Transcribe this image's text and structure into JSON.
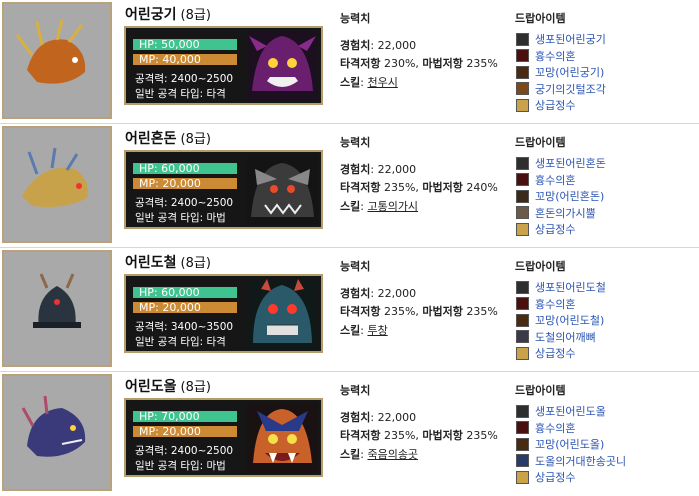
{
  "headers": {
    "ability": "능력치",
    "drop": "드랍아이템"
  },
  "labels": {
    "exp": "경험치",
    "resist": "타격저항",
    "magic_resist": "마법저항",
    "skill": "스킬",
    "attack": "공격력",
    "attack_type": "일반 공격 타입"
  },
  "monsters": [
    {
      "name": "어린궁기",
      "grade": "(8급)",
      "hp": "HP: 50,000",
      "mp": "MP: 40,000",
      "attack": "공격력: 2400~2500",
      "attack_type": "일반 공격 타입: 타격",
      "exp": ": 22,000",
      "resist": " 230%, ",
      "magic_resist": " 235%",
      "skill": ": ",
      "skill_name": "천우시",
      "drops": [
        "생포된어린궁기",
        "흉수의혼",
        "꼬망(어린궁기)",
        "궁기의깃털조각",
        "상급정수"
      ],
      "drop_icon_colors": [
        "#2e2e2e",
        "#4a1010",
        "#4a2a10",
        "#7a4a1a",
        "#c9a24a"
      ],
      "portrait_color": "#6a1f6e",
      "body_color": "#c0641e"
    },
    {
      "name": "어린혼돈",
      "grade": "(8급)",
      "hp": "HP: 60,000",
      "mp": "MP: 20,000",
      "attack": "공격력: 2400~2500",
      "attack_type": "일반 공격 타입: 마법",
      "exp": ": 22,000",
      "resist": " 235%, ",
      "magic_resist": " 240%",
      "skill": ": ",
      "skill_name": "고통의가시",
      "drops": [
        "생포된어린혼돈",
        "흉수의혼",
        "꼬망(어린혼돈)",
        "혼돈의가시뿔",
        "상급정수"
      ],
      "drop_icon_colors": [
        "#2e2e2e",
        "#4a1010",
        "#3a2a1a",
        "#6a5a4a",
        "#c9a24a"
      ],
      "portrait_color": "#3b3b3b",
      "body_color": "#c7a24a"
    },
    {
      "name": "어린도철",
      "grade": "(8급)",
      "hp": "HP: 60,000",
      "mp": "MP: 20,000",
      "attack": "공격력: 3400~3500",
      "attack_type": "일반 공격 타입: 타격",
      "exp": ": 22,000",
      "resist": " 235%, ",
      "magic_resist": " 235%",
      "skill": ": ",
      "skill_name": "투창",
      "drops": [
        "생포된어린도철",
        "흉수의혼",
        "꼬망(어린도철)",
        "도철의어깨뼈",
        "상급정수"
      ],
      "drop_icon_colors": [
        "#2e2e2e",
        "#4a1010",
        "#4a2a10",
        "#3a3a4a",
        "#c9a24a"
      ],
      "portrait_color": "#2a5a6a",
      "body_color": "#2a3440"
    },
    {
      "name": "어린도올",
      "grade": "(8급)",
      "hp": "HP: 70,000",
      "mp": "MP: 20,000",
      "attack": "공격력: 2400~2500",
      "attack_type": "일반 공격 타입: 마법",
      "exp": ": 22,000",
      "resist": " 235%, ",
      "magic_resist": " 235%",
      "skill": ": ",
      "skill_name": "죽음의송곳",
      "drops": [
        "생포된어린도올",
        "흉수의혼",
        "꼬망(어린도올)",
        "도올의거대한송곳니",
        "상급정수"
      ],
      "drop_icon_colors": [
        "#2e2e2e",
        "#4a1010",
        "#4a2a10",
        "#2a3a6a",
        "#c9a24a"
      ],
      "portrait_color": "#c8622a",
      "body_color": "#3a3a7a"
    }
  ]
}
